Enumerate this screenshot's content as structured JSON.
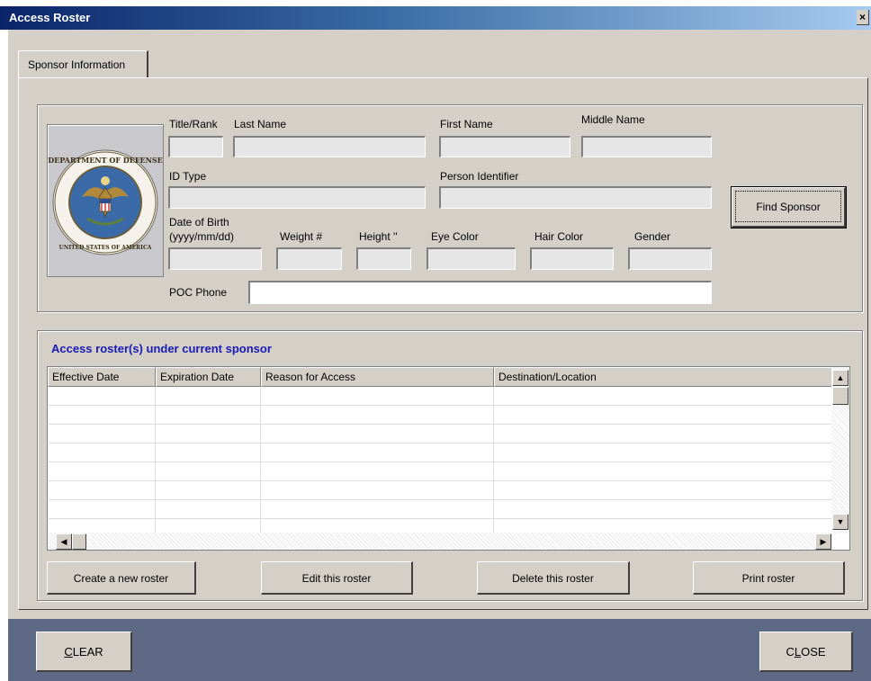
{
  "window": {
    "title": "Access Roster",
    "close_glyph": "×"
  },
  "tabs": [
    {
      "label": "Sponsor Information"
    }
  ],
  "sponsor": {
    "labels": {
      "title_rank": "Title/Rank",
      "last_name": "Last Name",
      "first_name": "First Name",
      "middle_name": "Middle Name",
      "id_type": "ID Type",
      "person_identifier": "Person Identifier",
      "dob_line1": "Date of Birth",
      "dob_line2": "(yyyy/mm/dd)",
      "weight": "Weight #",
      "height": "Height ''",
      "eye_color": "Eye Color",
      "hair_color": "Hair Color",
      "gender": "Gender",
      "poc_phone": "POC Phone"
    },
    "values": {
      "title_rank": "",
      "last_name": "",
      "first_name": "",
      "middle_name": "",
      "id_type": "",
      "person_identifier": "",
      "dob": "",
      "weight": "",
      "height": "",
      "eye_color": "",
      "hair_color": "",
      "gender": "",
      "poc_phone": ""
    },
    "find_button": "Find Sponsor",
    "seal": {
      "icon": "dept-of-defense-seal-icon",
      "ring_top": "DEPARTMENT OF DEFENSE",
      "ring_bottom": "UNITED STATES OF AMERICA"
    }
  },
  "rosters": {
    "heading": "Access roster(s) under current sponsor",
    "heading_color": "#1a1ab4",
    "columns": [
      "Effective Date",
      "Expiration Date",
      "Reason for Access",
      "Destination/Location"
    ],
    "rows": [],
    "buttons": {
      "create": "Create a new roster",
      "edit": "Edit this roster",
      "delete": "Delete this roster",
      "print": "Print roster"
    }
  },
  "footer": {
    "clear": {
      "prefix": "",
      "accel": "C",
      "rest": "LEAR"
    },
    "close": {
      "prefix": "C",
      "accel": "L",
      "rest": "OSE"
    }
  }
}
